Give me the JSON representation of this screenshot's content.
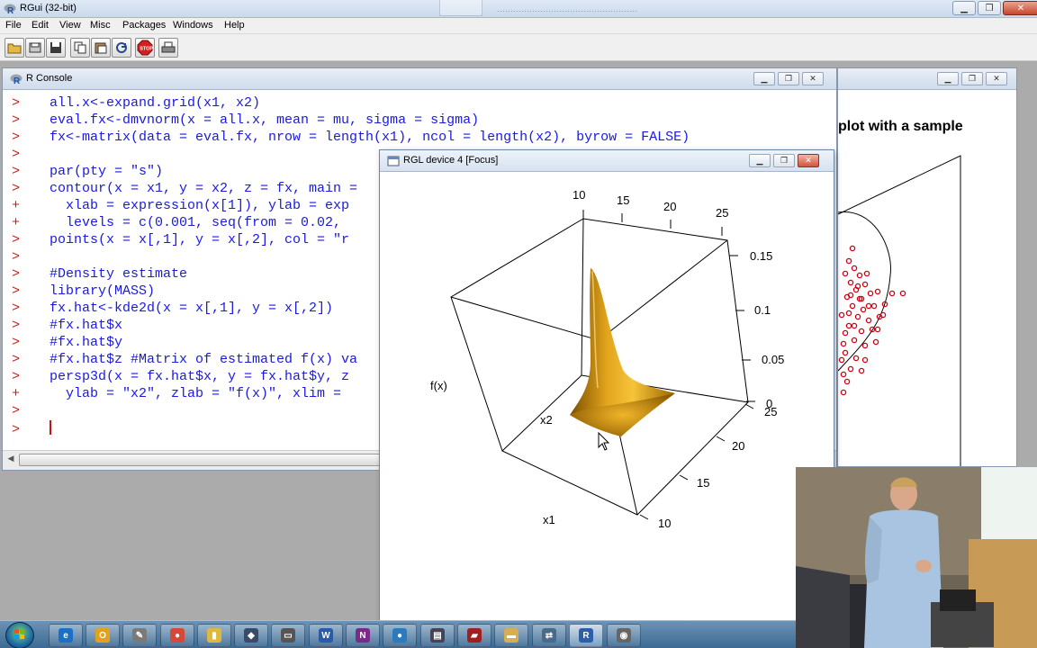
{
  "app": {
    "title": "RGui (32-bit)"
  },
  "menubar": {
    "items": [
      "File",
      "Edit",
      "View",
      "Misc",
      "Packages",
      "Windows",
      "Help"
    ]
  },
  "toolbar": {
    "buttons": [
      "open-script-icon",
      "load-workspace-icon",
      "save-workspace-icon",
      "copy-icon",
      "paste-icon",
      "copy-paste-icon",
      "refresh-icon",
      "stop-icon",
      "print-icon"
    ]
  },
  "console": {
    "title": "R Console",
    "lines": [
      {
        "prompt": ">",
        "code": "all.x<-expand.grid(x1, x2)"
      },
      {
        "prompt": ">",
        "code": "eval.fx<-dmvnorm(x = all.x, mean = mu, sigma = sigma)"
      },
      {
        "prompt": ">",
        "code": "fx<-matrix(data = eval.fx, nrow = length(x1), ncol = length(x2), byrow = FALSE)"
      },
      {
        "prompt": ">",
        "code": ""
      },
      {
        "prompt": ">",
        "code": "par(pty = \"s\")"
      },
      {
        "prompt": ">",
        "code": "contour(x = x1, y = x2, z = fx, main ="
      },
      {
        "prompt": "+",
        "code": "  xlab = expression(x[1]), ylab = exp"
      },
      {
        "prompt": "+",
        "code": "  levels = c(0.001, seq(from = 0.02,"
      },
      {
        "prompt": ">",
        "code": "points(x = x[,1], y = x[,2], col = \"r"
      },
      {
        "prompt": ">",
        "code": ""
      },
      {
        "prompt": ">",
        "code": "#Density estimate"
      },
      {
        "prompt": ">",
        "code": "library(MASS)"
      },
      {
        "prompt": ">",
        "code": "fx.hat<-kde2d(x = x[,1], y = x[,2])"
      },
      {
        "prompt": ">",
        "code": "#fx.hat$x"
      },
      {
        "prompt": ">",
        "code": "#fx.hat$y"
      },
      {
        "prompt": ">",
        "code": "#fx.hat$z #Matrix of estimated f(x) va"
      },
      {
        "prompt": ">",
        "code": "persp3d(x = fx.hat$x, y = fx.hat$y, z"
      },
      {
        "prompt": "+",
        "code": "  ylab = \"x2\", zlab = \"f(x)\", xlim ="
      },
      {
        "prompt": ">",
        "code": ""
      },
      {
        "prompt": ">",
        "code": ""
      }
    ]
  },
  "plot_window": {
    "title_fragment": "plot with a sample"
  },
  "rgl": {
    "title": "RGL device 4 [Focus]",
    "axes": {
      "x1_label": "x1",
      "x2_label": "x2",
      "z_label": "f(x)",
      "x1_ticks": [
        "10",
        "15",
        "20",
        "25"
      ],
      "x2_ticks": [
        "10",
        "15",
        "20",
        "25"
      ],
      "z_ticks": [
        "0",
        "0.05",
        "0.1",
        "0.15"
      ]
    }
  },
  "taskbar": {
    "items": [
      {
        "icon": "ie-icon",
        "glyph": "e",
        "color": "#1c6fc4"
      },
      {
        "icon": "outlook-icon",
        "glyph": "O",
        "color": "#e3a21a"
      },
      {
        "icon": "pen-icon",
        "glyph": "✎",
        "color": "#7a7a7a"
      },
      {
        "icon": "chrome-icon",
        "glyph": "●",
        "color": "#d44a3a"
      },
      {
        "icon": "folder-doc-icon",
        "glyph": "▮",
        "color": "#e0b840"
      },
      {
        "icon": "app-icon",
        "glyph": "◆",
        "color": "#3a4a6a"
      },
      {
        "icon": "window-icon",
        "glyph": "▭",
        "color": "#555"
      },
      {
        "icon": "word-icon",
        "glyph": "W",
        "color": "#2a5aa8"
      },
      {
        "icon": "onenote-icon",
        "glyph": "N",
        "color": "#7a2a8a"
      },
      {
        "icon": "hp-icon",
        "glyph": "●",
        "color": "#2a7ac0"
      },
      {
        "icon": "document-icon",
        "glyph": "▤",
        "color": "#445"
      },
      {
        "icon": "pdf-icon",
        "glyph": "▰",
        "color": "#a02020"
      },
      {
        "icon": "explorer-icon",
        "glyph": "▬",
        "color": "#d6b050"
      },
      {
        "icon": "network-icon",
        "glyph": "⇄",
        "color": "#4a6a8a"
      },
      {
        "icon": "r-icon",
        "glyph": "R",
        "color": "#2f5ea8"
      },
      {
        "icon": "camera-icon",
        "glyph": "◉",
        "color": "#666"
      }
    ]
  }
}
